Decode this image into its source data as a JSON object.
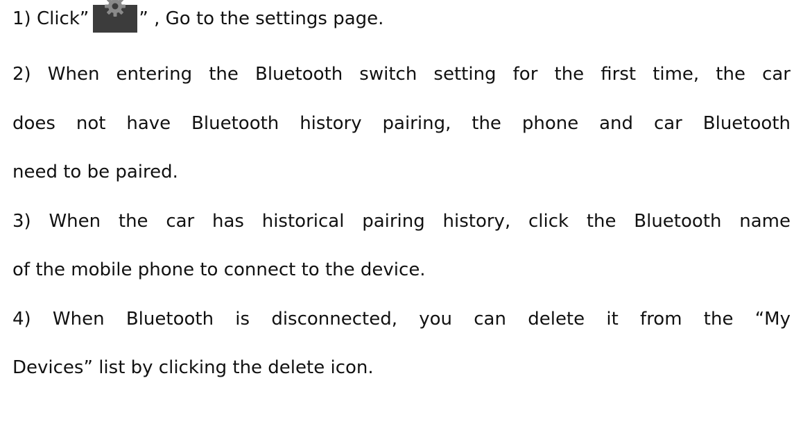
{
  "doc": {
    "step1": {
      "before": "1)  Click”",
      "after": "” , Go to the settings page.",
      "icon": "gear-icon"
    },
    "step2_lines": [
      "2)  When entering the Bluetooth switch setting for the first time, the car",
      "does not have Bluetooth history pairing, the phone and car Bluetooth",
      "need to be paired."
    ],
    "step3_lines": [
      "3)  When the car has historical pairing history, click the Bluetooth name",
      "of the mobile phone to connect to the device."
    ],
    "step4_lines": [
      "4)  When Bluetooth is disconnected, you can delete it from the  “My",
      "Devices”  list by clicking the delete icon."
    ]
  }
}
